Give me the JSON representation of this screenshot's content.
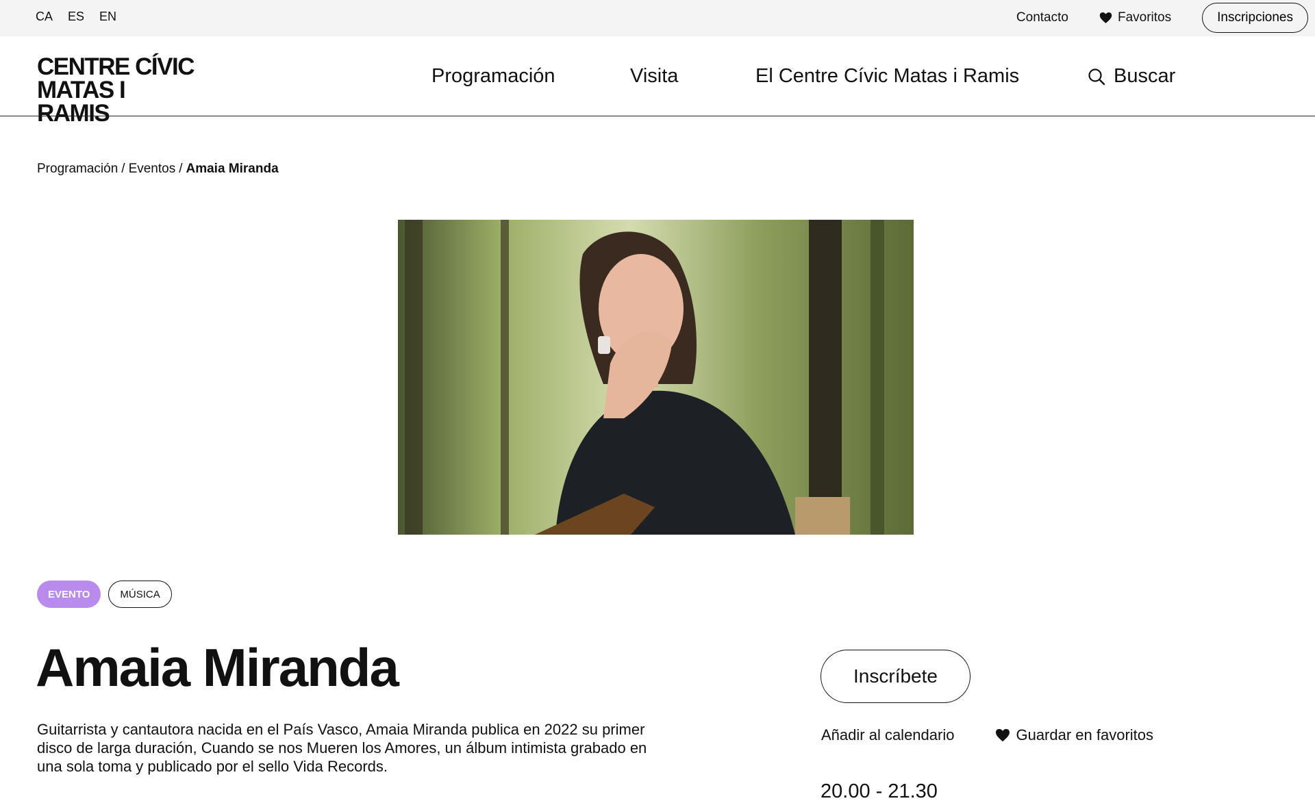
{
  "colors": {
    "accent_tag": "#b98bec",
    "topbar_bg": "#f4f4f4",
    "text": "#111111"
  },
  "topbar": {
    "languages": [
      "CA",
      "ES",
      "EN"
    ],
    "contact": "Contacto",
    "favorites": "Favoritos",
    "favorites_icon": "heart-icon",
    "signup": "Inscripciones"
  },
  "logo": {
    "line1": "CENTRE CÍVIC",
    "line2": "MATAS I RAMIS"
  },
  "nav": {
    "items": [
      "Programación",
      "Visita",
      "El Centre Cívic Matas i Ramis"
    ],
    "search": "Buscar",
    "search_icon": "search-icon"
  },
  "breadcrumb": [
    "Programación",
    "Eventos",
    "Amaia Miranda"
  ],
  "hero": {
    "description": "Photo of a woman with a guitar in a forest"
  },
  "tags": [
    "EVENTO",
    "MÚSICA"
  ],
  "event": {
    "title": "Amaia Miranda",
    "description": "Guitarrista y cantautora nacida en el País Vasco, Amaia Miranda publica en 2022 su primer disco de larga duración, Cuando se nos Mueren los Amores, un álbum intimista grabado en una sola toma y publicado por el sello Vida Records.",
    "register": "Inscríbete",
    "add_calendar": "Añadir al calendario",
    "save_favorites": "Guardar en favoritos",
    "time": "20.00 - 21.30"
  }
}
